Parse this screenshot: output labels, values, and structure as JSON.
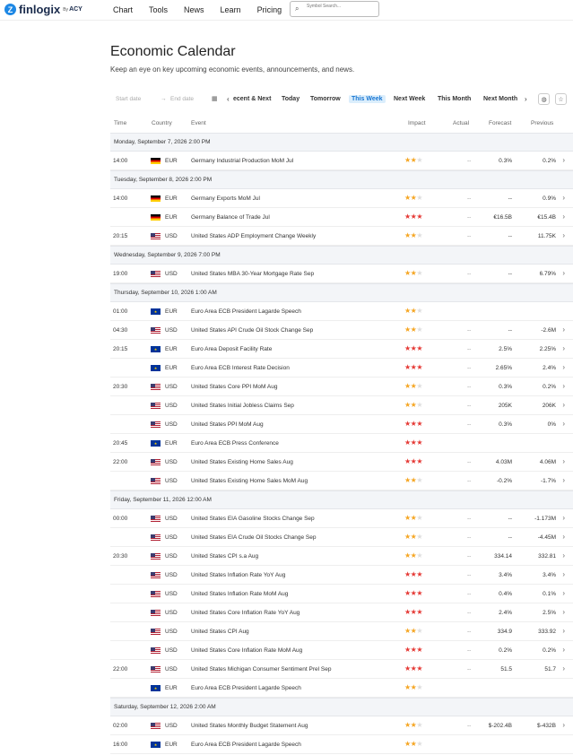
{
  "brand": {
    "logo_glyph": "Z",
    "name": "finlogix",
    "by": "By",
    "partner": "ACY"
  },
  "nav": {
    "items": [
      "Chart",
      "Tools",
      "News",
      "Learn",
      "Pricing"
    ]
  },
  "search": {
    "placeholder": "Symbol Search..."
  },
  "page": {
    "title": "Economic Calendar",
    "subtitle": "Keep an eye on key upcoming economic events, announcements, and news."
  },
  "filters": {
    "start_date_placeholder": "Start date",
    "end_date_placeholder": "End date",
    "tabs": [
      "ecent & Next",
      "Today",
      "Tomorrow",
      "This Week",
      "Next Week",
      "This Month",
      "Next Month"
    ],
    "active_tab": "This Week"
  },
  "columns": {
    "time": "Time",
    "country": "Country",
    "event": "Event",
    "impact": "Impact",
    "actual": "Actual",
    "forecast": "Forecast",
    "previous": "Previous"
  },
  "colors": {
    "accent": "#1976d2",
    "high_impact": "#e53935",
    "medium_impact": "#f5a623"
  },
  "days": [
    {
      "date": "Monday, September 7, 2026 2:00 PM",
      "events": [
        {
          "time": "14:00",
          "flag": "de",
          "currency": "EUR",
          "event": "Germany Industrial Production MoM Jul",
          "impact": 2,
          "actual": "--",
          "forecast": "0.3%",
          "previous": "0.2%"
        }
      ]
    },
    {
      "date": "Tuesday, September 8, 2026 2:00 PM",
      "events": [
        {
          "time": "14:00",
          "flag": "de",
          "currency": "EUR",
          "event": "Germany Exports MoM Jul",
          "impact": 2,
          "actual": "--",
          "forecast": "--",
          "previous": "0.9%"
        },
        {
          "time": "",
          "flag": "de",
          "currency": "EUR",
          "event": "Germany Balance of Trade Jul",
          "impact": 3,
          "actual": "--",
          "forecast": "€16.5B",
          "previous": "€15.4B"
        },
        {
          "time": "20:15",
          "flag": "us",
          "currency": "USD",
          "event": "United States ADP Employment Change Weekly",
          "impact": 2,
          "actual": "--",
          "forecast": "--",
          "previous": "11.75K"
        }
      ]
    },
    {
      "date": "Wednesday, September 9, 2026 7:00 PM",
      "events": [
        {
          "time": "19:00",
          "flag": "us",
          "currency": "USD",
          "event": "United States MBA 30-Year Mortgage Rate Sep",
          "impact": 2,
          "actual": "--",
          "forecast": "--",
          "previous": "6.79%"
        }
      ]
    },
    {
      "date": "Thursday, September 10, 2026 1:00 AM",
      "events": [
        {
          "time": "01:00",
          "flag": "eu",
          "currency": "EUR",
          "event": "Euro Area ECB President Lagarde Speech",
          "impact": 2,
          "actual": "",
          "forecast": "",
          "previous": ""
        },
        {
          "time": "04:30",
          "flag": "us",
          "currency": "USD",
          "event": "United States API Crude Oil Stock Change Sep",
          "impact": 2,
          "actual": "--",
          "forecast": "--",
          "previous": "-2.6M"
        },
        {
          "time": "20:15",
          "flag": "eu",
          "currency": "EUR",
          "event": "Euro Area Deposit Facility Rate",
          "impact": 3,
          "actual": "--",
          "forecast": "2.5%",
          "previous": "2.25%"
        },
        {
          "time": "",
          "flag": "eu",
          "currency": "EUR",
          "event": "Euro Area ECB Interest Rate Decision",
          "impact": 3,
          "actual": "--",
          "forecast": "2.65%",
          "previous": "2.4%"
        },
        {
          "time": "20:30",
          "flag": "us",
          "currency": "USD",
          "event": "United States Core PPI MoM Aug",
          "impact": 2,
          "actual": "--",
          "forecast": "0.3%",
          "previous": "0.2%"
        },
        {
          "time": "",
          "flag": "us",
          "currency": "USD",
          "event": "United States Initial Jobless Claims Sep",
          "impact": 2,
          "actual": "--",
          "forecast": "205K",
          "previous": "206K"
        },
        {
          "time": "",
          "flag": "us",
          "currency": "USD",
          "event": "United States PPI MoM Aug",
          "impact": 3,
          "actual": "--",
          "forecast": "0.3%",
          "previous": "0%"
        },
        {
          "time": "20:45",
          "flag": "eu",
          "currency": "EUR",
          "event": "Euro Area ECB Press Conference",
          "impact": 3,
          "actual": "",
          "forecast": "",
          "previous": ""
        },
        {
          "time": "22:00",
          "flag": "us",
          "currency": "USD",
          "event": "United States Existing Home Sales Aug",
          "impact": 3,
          "actual": "--",
          "forecast": "4.03M",
          "previous": "4.06M"
        },
        {
          "time": "",
          "flag": "us",
          "currency": "USD",
          "event": "United States Existing Home Sales MoM Aug",
          "impact": 2,
          "actual": "--",
          "forecast": "-0.2%",
          "previous": "-1.7%"
        }
      ]
    },
    {
      "date": "Friday, September 11, 2026 12:00 AM",
      "events": [
        {
          "time": "00:00",
          "flag": "us",
          "currency": "USD",
          "event": "United States EIA Gasoline Stocks Change Sep",
          "impact": 2,
          "actual": "--",
          "forecast": "--",
          "previous": "-1.173M"
        },
        {
          "time": "",
          "flag": "us",
          "currency": "USD",
          "event": "United States EIA Crude Oil Stocks Change Sep",
          "impact": 2,
          "actual": "--",
          "forecast": "--",
          "previous": "-4.45M"
        },
        {
          "time": "20:30",
          "flag": "us",
          "currency": "USD",
          "event": "United States CPI s.a Aug",
          "impact": 2,
          "actual": "--",
          "forecast": "334.14",
          "previous": "332.81"
        },
        {
          "time": "",
          "flag": "us",
          "currency": "USD",
          "event": "United States Inflation Rate YoY Aug",
          "impact": 3,
          "actual": "--",
          "forecast": "3.4%",
          "previous": "3.4%"
        },
        {
          "time": "",
          "flag": "us",
          "currency": "USD",
          "event": "United States Inflation Rate MoM Aug",
          "impact": 3,
          "actual": "--",
          "forecast": "0.4%",
          "previous": "0.1%"
        },
        {
          "time": "",
          "flag": "us",
          "currency": "USD",
          "event": "United States Core Inflation Rate YoY Aug",
          "impact": 3,
          "actual": "--",
          "forecast": "2.4%",
          "previous": "2.5%"
        },
        {
          "time": "",
          "flag": "us",
          "currency": "USD",
          "event": "United States CPI Aug",
          "impact": 2,
          "actual": "--",
          "forecast": "334.9",
          "previous": "333.92"
        },
        {
          "time": "",
          "flag": "us",
          "currency": "USD",
          "event": "United States Core Inflation Rate MoM Aug",
          "impact": 3,
          "actual": "--",
          "forecast": "0.2%",
          "previous": "0.2%"
        },
        {
          "time": "22:00",
          "flag": "us",
          "currency": "USD",
          "event": "United States Michigan Consumer Sentiment Prel Sep",
          "impact": 3,
          "actual": "--",
          "forecast": "51.5",
          "previous": "51.7"
        },
        {
          "time": "",
          "flag": "eu",
          "currency": "EUR",
          "event": "Euro Area ECB President Lagarde Speech",
          "impact": 2,
          "actual": "",
          "forecast": "",
          "previous": ""
        }
      ]
    },
    {
      "date": "Saturday, September 12, 2026 2:00 AM",
      "events": [
        {
          "time": "02:00",
          "flag": "us",
          "currency": "USD",
          "event": "United States Monthly Budget Statement Aug",
          "impact": 2,
          "actual": "--",
          "forecast": "$-202.4B",
          "previous": "$-432B"
        },
        {
          "time": "16:00",
          "flag": "eu",
          "currency": "EUR",
          "event": "Euro Area ECB President Lagarde Speech",
          "impact": 2,
          "actual": "",
          "forecast": "",
          "previous": ""
        }
      ]
    }
  ]
}
